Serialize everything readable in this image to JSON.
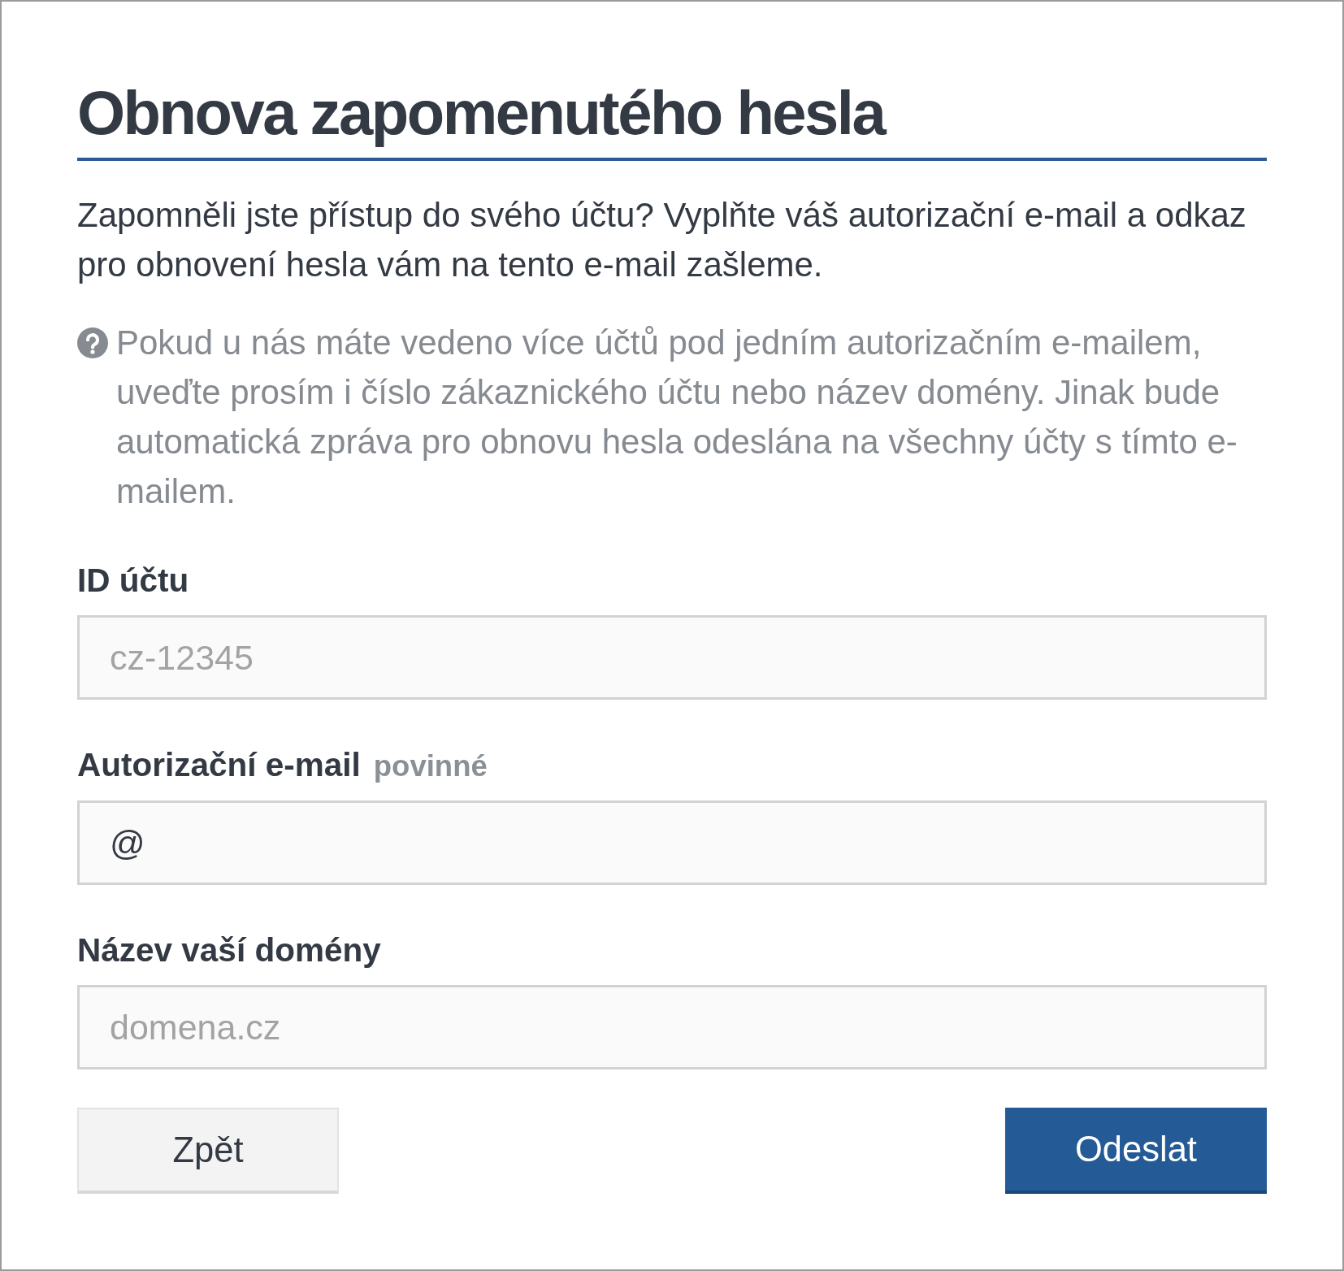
{
  "title": "Obnova zapomenutého hesla",
  "intro": "Zapomněli jste přístup do svého účtu? Vyplňte váš autorizační e-mail a odkaz pro obnovení hesla vám na tento e-mail zašleme.",
  "hint": "Pokud u nás máte vedeno více účtů pod jedním autorizačním e-mailem, uveďte prosím i číslo zákaznického účtu nebo název domény. Jinak bude automatická zpráva pro obnovu hesla odeslána na všechny účty s tímto e-mailem.",
  "fields": [
    {
      "label": "ID účtu",
      "placeholder": "cz-12345"
    },
    {
      "label": "Autorizační e-mail",
      "required_note": "povinné",
      "value": "@"
    },
    {
      "label": "Název vaší domény",
      "placeholder": "domena.cz"
    }
  ],
  "buttons": [
    {
      "label": "Zpět",
      "kind": "secondary"
    },
    {
      "label": "Odeslat",
      "kind": "primary"
    }
  ]
}
